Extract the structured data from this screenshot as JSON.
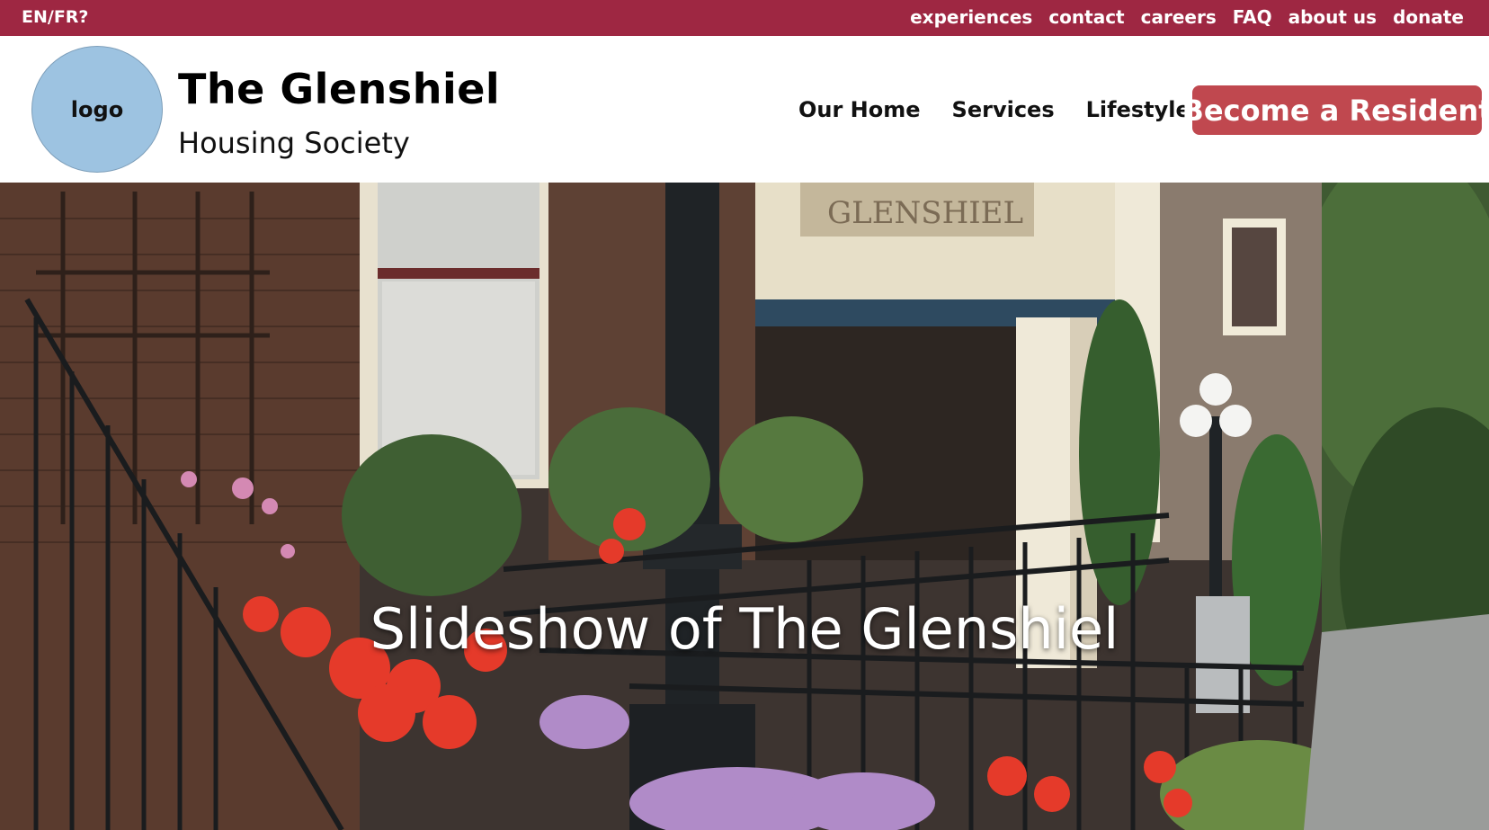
{
  "topbar": {
    "lang_toggle": "EN/FR?",
    "links": [
      "experiences",
      "contact",
      "careers",
      "FAQ",
      "about us",
      "donate"
    ]
  },
  "header": {
    "logo_label": "logo",
    "title": "The Glenshiel",
    "subtitle": "Housing Society",
    "nav": [
      "Our Home",
      "Services",
      "Lifestyle"
    ],
    "cta_label": "Become a Resident"
  },
  "hero": {
    "caption": "Slideshow of The Glenshiel",
    "building_sign": "GLENSHIEL"
  },
  "colors": {
    "topbar_bg": "#9e2742",
    "cta_bg": "#c0484f",
    "logo_bg": "#9dc3e1"
  }
}
